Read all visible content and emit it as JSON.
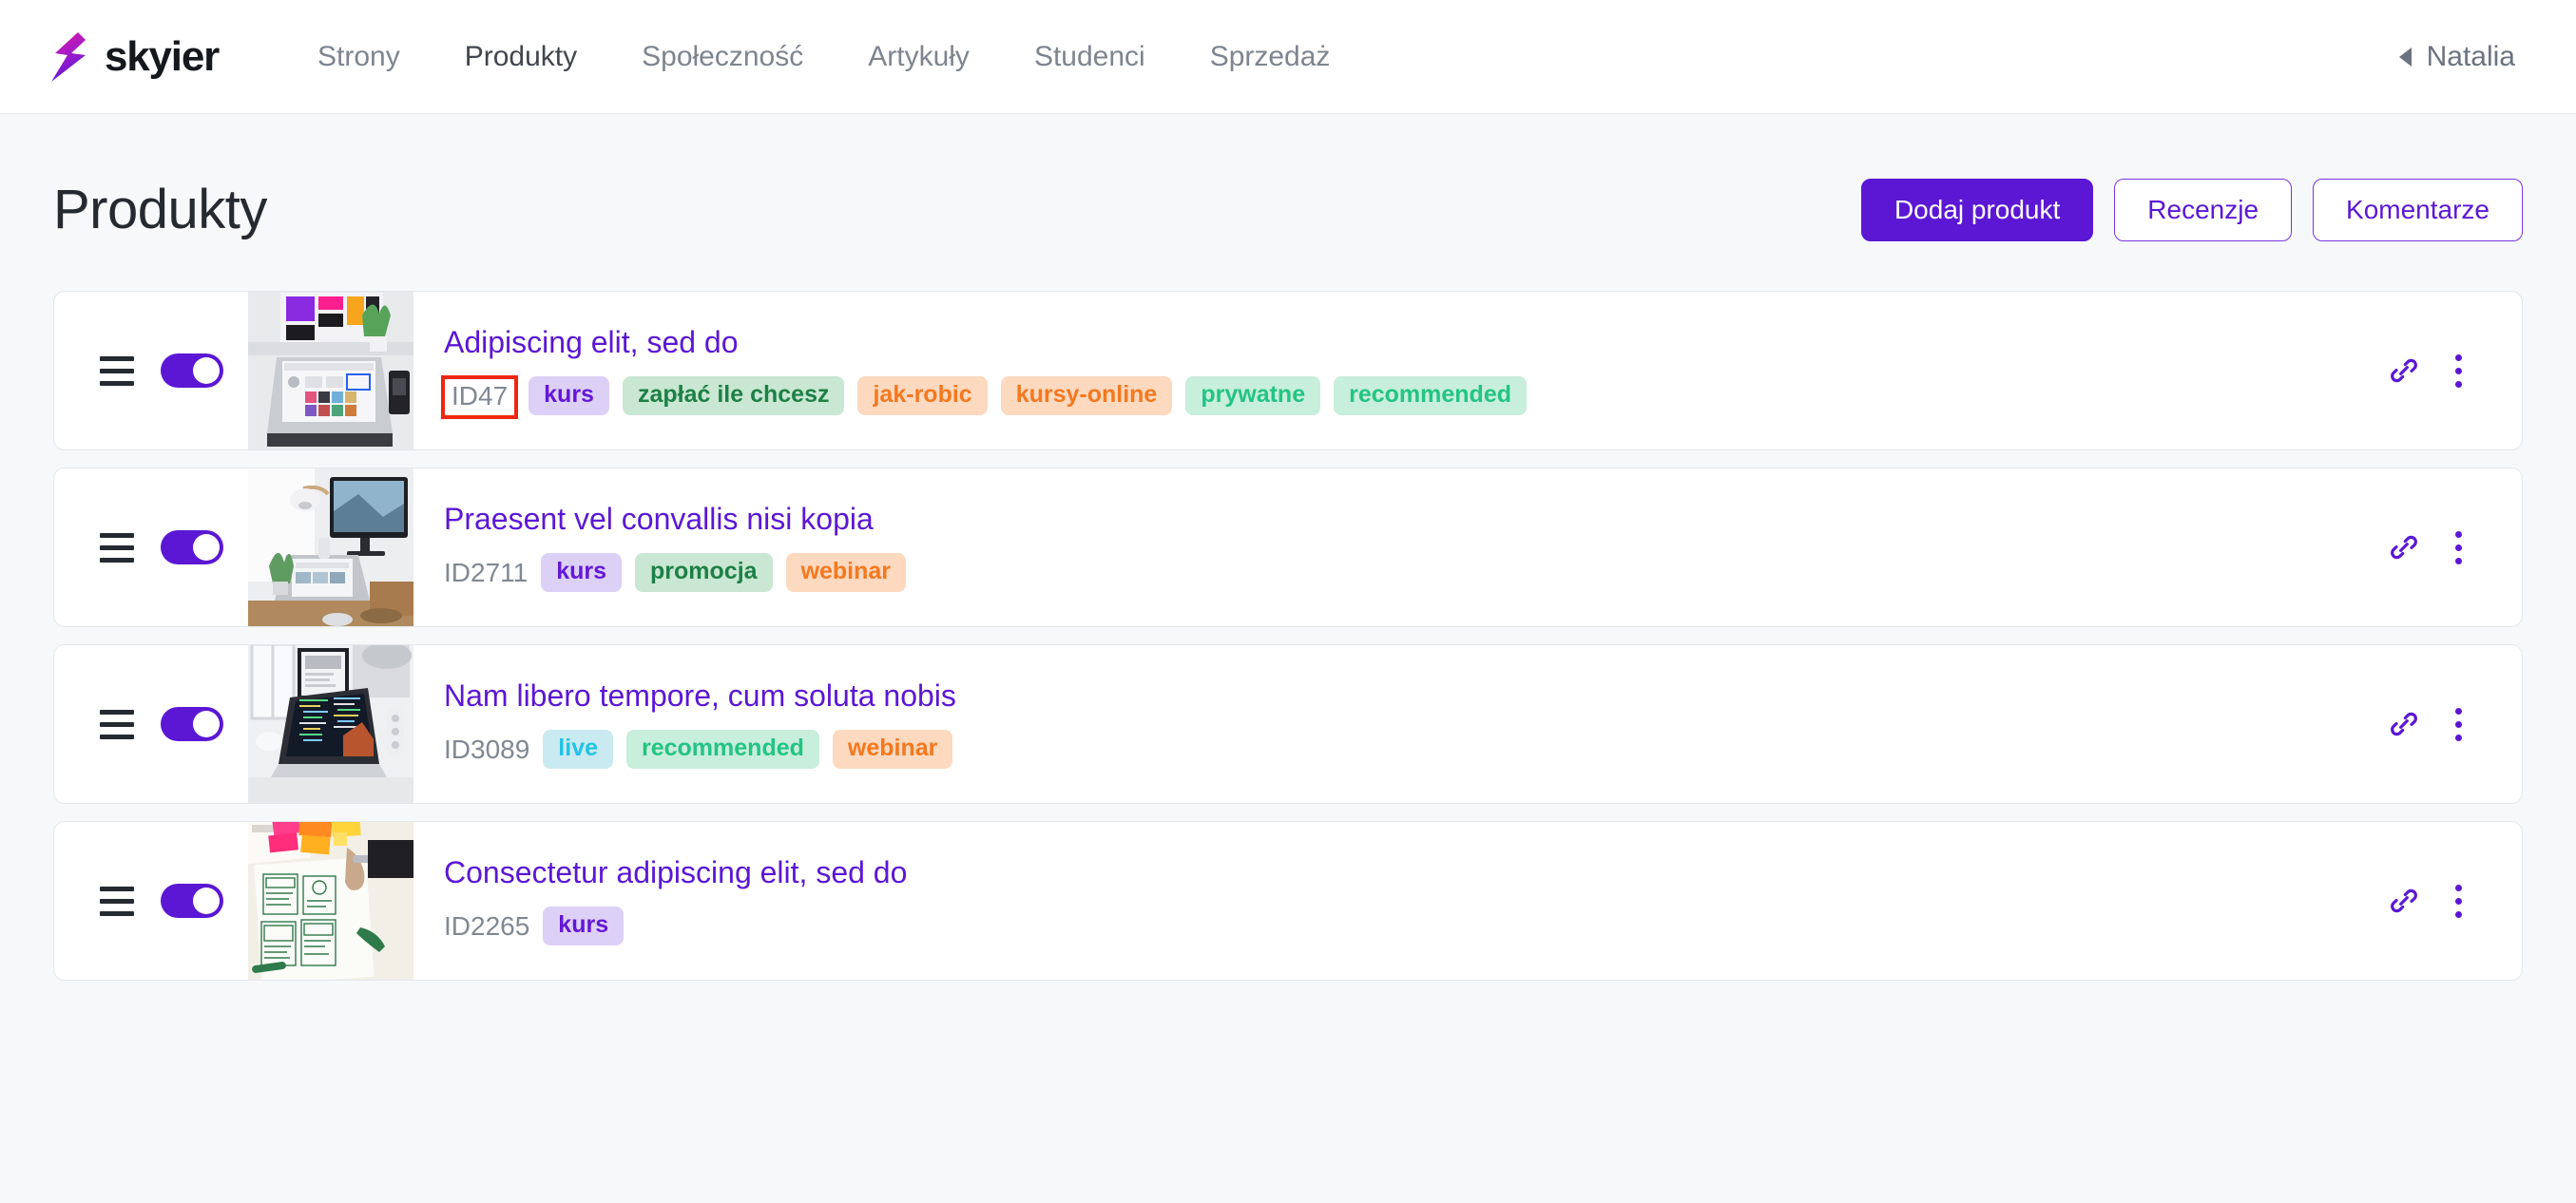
{
  "brand": {
    "name": "skyier",
    "logo_icon": "lightning-bolt-icon"
  },
  "nav": {
    "items": [
      {
        "label": "Strony",
        "active": false
      },
      {
        "label": "Produkty",
        "active": true
      },
      {
        "label": "Społeczność",
        "active": false
      },
      {
        "label": "Artykuły",
        "active": false
      },
      {
        "label": "Studenci",
        "active": false
      },
      {
        "label": "Sprzedaż",
        "active": false
      }
    ]
  },
  "user": {
    "name": "Natalia",
    "caret_icon": "caret-left-icon"
  },
  "page": {
    "title": "Produkty"
  },
  "actions": {
    "add_product": "Dodaj produkt",
    "reviews": "Recenzje",
    "comments": "Komentarze"
  },
  "colors": {
    "accent": "#5b17d4",
    "page_bg": "#f6f8fa",
    "card_bg": "#ffffff",
    "card_border": "#e3e7ec",
    "highlight": "#f0260f",
    "tag_purple_bg": "#ddd0f7",
    "tag_purple_fg": "#6318d6",
    "tag_green_bg": "#c9e7d2",
    "tag_green_fg": "#1d8047",
    "tag_orange_bg": "#fcd9bf",
    "tag_orange_fg": "#f4781f",
    "tag_teal_bg": "#c8eedc",
    "tag_teal_fg": "#23c482",
    "tag_cyan_bg": "#c9eaf0",
    "tag_cyan_fg": "#22c3e6"
  },
  "products": [
    {
      "id": "ID47",
      "id_highlighted": true,
      "title": "Adipiscing elit, sed do",
      "enabled": true,
      "thumb": "desk-with-laptop-and-monitor",
      "tags": [
        {
          "label": "kurs",
          "color": "purple"
        },
        {
          "label": "zapłać ile chcesz",
          "color": "green"
        },
        {
          "label": "jak-robic",
          "color": "orange"
        },
        {
          "label": "kursy-online",
          "color": "orange"
        },
        {
          "label": "prywatne",
          "color": "teal"
        },
        {
          "label": "recommended",
          "color": "teal"
        }
      ]
    },
    {
      "id": "ID2711",
      "id_highlighted": false,
      "title": "Praesent vel convallis nisi kopia",
      "enabled": true,
      "thumb": "bright-desk-laptop-lamp",
      "tags": [
        {
          "label": "kurs",
          "color": "purple"
        },
        {
          "label": "promocja",
          "color": "green"
        },
        {
          "label": "webinar",
          "color": "orange"
        }
      ]
    },
    {
      "id": "ID3089",
      "id_highlighted": false,
      "title": "Nam libero tempore, cum soluta nobis",
      "enabled": true,
      "thumb": "laptop-with-code-editor",
      "tags": [
        {
          "label": "live",
          "color": "cyan"
        },
        {
          "label": "recommended",
          "color": "teal"
        },
        {
          "label": "webinar",
          "color": "orange"
        }
      ]
    },
    {
      "id": "ID2265",
      "id_highlighted": false,
      "title": "Consectetur adipiscing elit, sed do",
      "enabled": true,
      "thumb": "wireframe-sketches-sticky-notes",
      "tags": [
        {
          "label": "kurs",
          "color": "purple"
        }
      ]
    }
  ],
  "row_actions": {
    "link_icon": "chain-link-icon",
    "menu_icon": "more-vertical-icon"
  }
}
